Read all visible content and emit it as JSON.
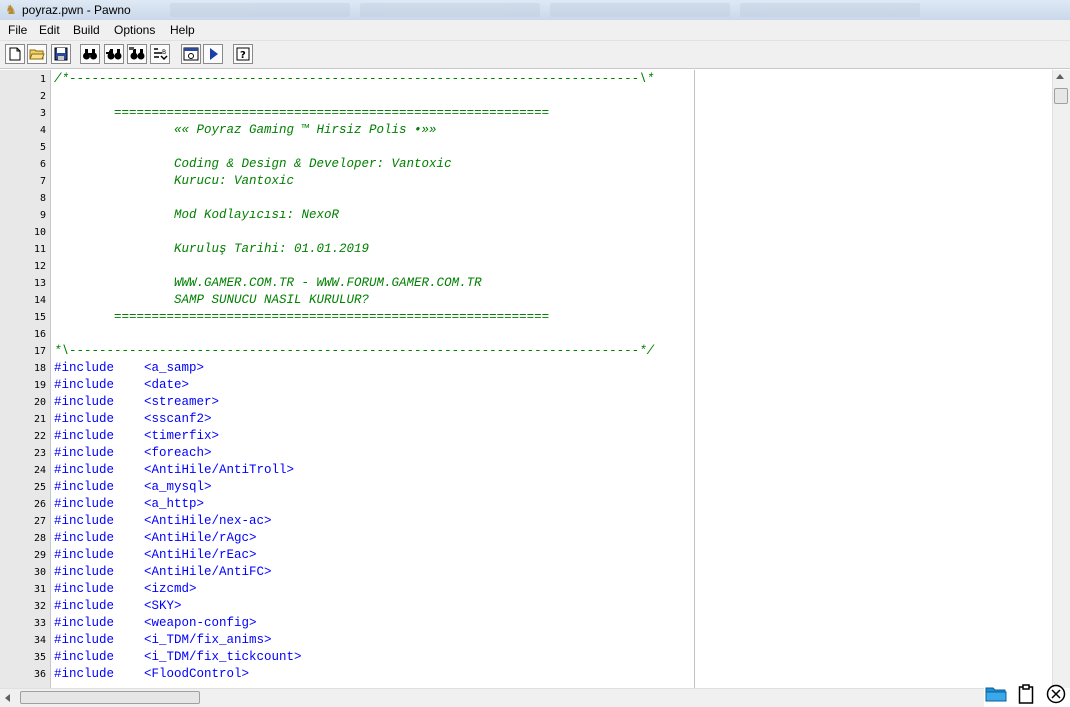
{
  "window": {
    "title": "poyraz.pwn - Pawno"
  },
  "menu": [
    "File",
    "Edit",
    "Build",
    "Options",
    "Help"
  ],
  "toolbar": {
    "buttons": [
      "new-file-icon",
      "open-folder-icon",
      "save-icon",
      "find-icon",
      "find-next-icon",
      "replace-icon",
      "goto-line-icon",
      "compile-icon",
      "run-icon",
      "help-icon"
    ]
  },
  "editor": {
    "lines": [
      {
        "n": "1",
        "text": "/*----------------------------------------------------------------------------\\*",
        "type": "comment"
      },
      {
        "n": "2",
        "text": "",
        "type": "comment"
      },
      {
        "n": "3",
        "text": "        ==========================================================",
        "type": "comment"
      },
      {
        "n": "4",
        "text": "                «« Poyraz Gaming ™ Hirsiz Polis •»»",
        "type": "comment"
      },
      {
        "n": "5",
        "text": "",
        "type": "comment"
      },
      {
        "n": "6",
        "text": "                Coding & Design & Developer: Vantoxic",
        "type": "comment"
      },
      {
        "n": "7",
        "text": "                Kurucu: Vantoxic",
        "type": "comment"
      },
      {
        "n": "8",
        "text": "",
        "type": "comment"
      },
      {
        "n": "9",
        "text": "                Mod Kodlayıcısı: NexoR",
        "type": "comment"
      },
      {
        "n": "10",
        "text": "",
        "type": "comment"
      },
      {
        "n": "11",
        "text": "                Kuruluş Tarihi: 01.01.2019",
        "type": "comment"
      },
      {
        "n": "12",
        "text": "",
        "type": "comment"
      },
      {
        "n": "13",
        "text": "                WWW.GAMER.COM.TR - WWW.FORUM.GAMER.COM.TR",
        "type": "comment"
      },
      {
        "n": "14",
        "text": "                SAMP SUNUCU NASIL KURULUR?",
        "type": "comment"
      },
      {
        "n": "15",
        "text": "        ==========================================================",
        "type": "comment"
      },
      {
        "n": "16",
        "text": "",
        "type": "comment"
      },
      {
        "n": "17",
        "text": "*\\----------------------------------------------------------------------------*/",
        "type": "comment"
      },
      {
        "n": "18",
        "text": "#include    <a_samp>",
        "type": "directive"
      },
      {
        "n": "19",
        "text": "#include    <date>",
        "type": "directive"
      },
      {
        "n": "20",
        "text": "#include    <streamer>",
        "type": "directive"
      },
      {
        "n": "21",
        "text": "#include    <sscanf2>",
        "type": "directive"
      },
      {
        "n": "22",
        "text": "#include    <timerfix>",
        "type": "directive"
      },
      {
        "n": "23",
        "text": "#include    <foreach>",
        "type": "directive"
      },
      {
        "n": "24",
        "text": "#include    <AntiHile/AntiTroll>",
        "type": "directive"
      },
      {
        "n": "25",
        "text": "#include    <a_mysql>",
        "type": "directive"
      },
      {
        "n": "26",
        "text": "#include    <a_http>",
        "type": "directive"
      },
      {
        "n": "27",
        "text": "#include    <AntiHile/nex-ac>",
        "type": "directive"
      },
      {
        "n": "28",
        "text": "#include    <AntiHile/rAgc>",
        "type": "directive"
      },
      {
        "n": "29",
        "text": "#include    <AntiHile/rEac>",
        "type": "directive"
      },
      {
        "n": "30",
        "text": "#include    <AntiHile/AntiFC>",
        "type": "directive"
      },
      {
        "n": "31",
        "text": "#include    <izcmd>",
        "type": "directive"
      },
      {
        "n": "32",
        "text": "#include    <SKY>",
        "type": "directive"
      },
      {
        "n": "33",
        "text": "#include    <weapon-config>",
        "type": "directive"
      },
      {
        "n": "34",
        "text": "#include    <i_TDM/fix_anims>",
        "type": "directive"
      },
      {
        "n": "35",
        "text": "#include    <i_TDM/fix_tickcount>",
        "type": "directive"
      },
      {
        "n": "36",
        "text": "#include    <FloodControl>",
        "type": "directive"
      }
    ]
  },
  "colors": {
    "comment": "#008000",
    "directive": "#0000ff",
    "gutter": "#e8e8e8"
  },
  "tray": [
    "folder-icon",
    "clipboard-icon",
    "close-circle-icon"
  ]
}
